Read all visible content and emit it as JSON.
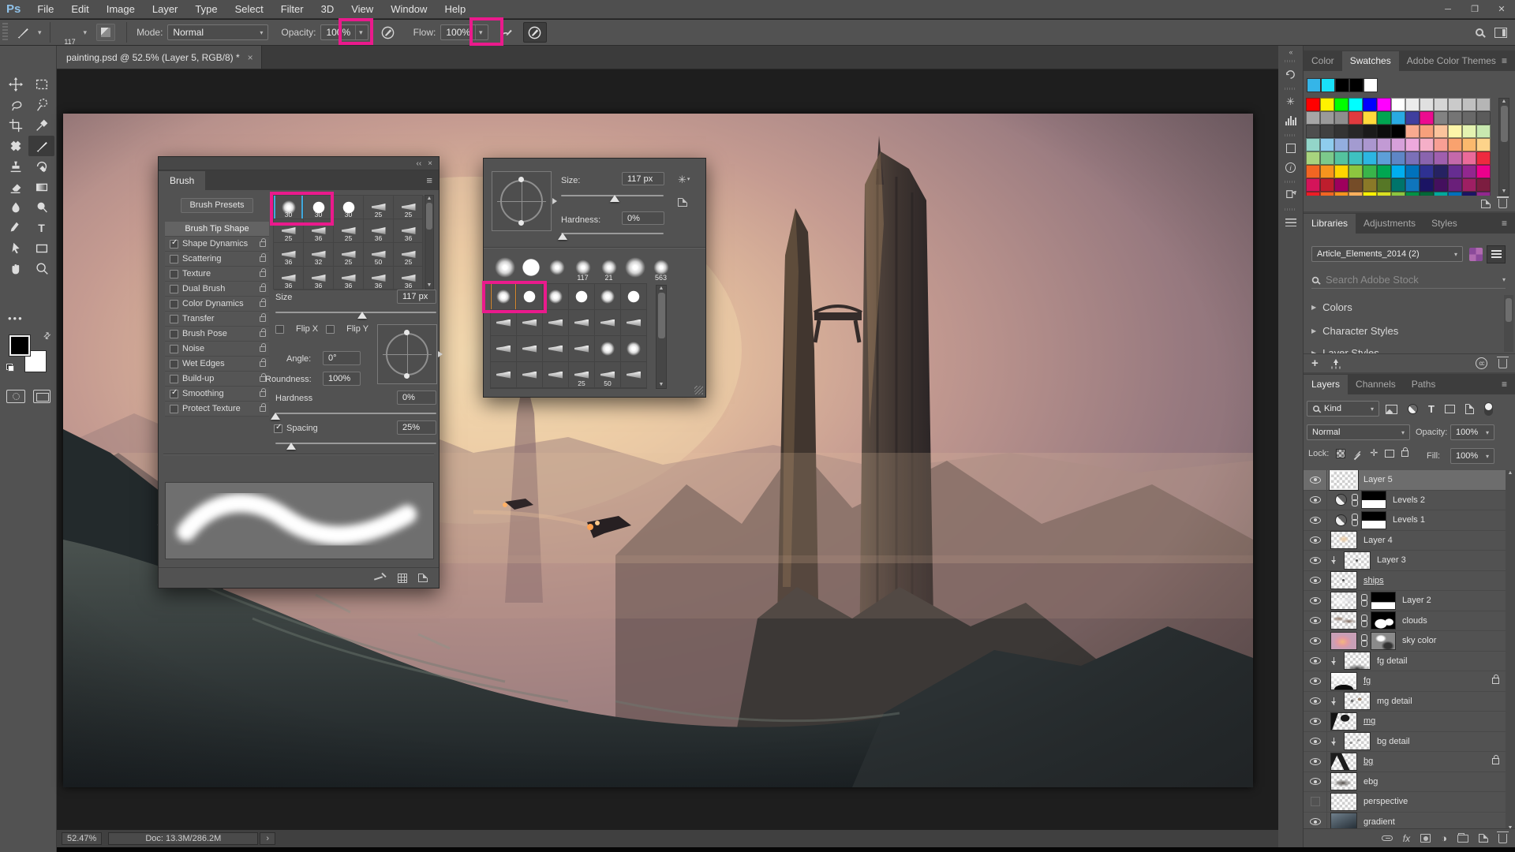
{
  "app": {
    "logo": "Ps",
    "window_controls": [
      "─",
      "❐",
      "✕"
    ]
  },
  "menu": [
    "File",
    "Edit",
    "Image",
    "Layer",
    "Type",
    "Select",
    "Filter",
    "3D",
    "View",
    "Window",
    "Help"
  ],
  "icons": {
    "chevron": "▾",
    "menu": "≡",
    "close": "×",
    "collapse": "‹‹",
    "tri": "▶",
    "up": "▲",
    "down": "▼",
    "ellipsis": "•••",
    "fx": "fx",
    "cc": "cc",
    "swap": "⇄",
    "asterisk": "✳",
    "T": "T",
    "halfcircle": "◑",
    "info": "i",
    "gt": "›"
  },
  "options_bar": {
    "brush_size": "117",
    "mode_label": "Mode:",
    "mode_value": "Normal",
    "opacity_label": "Opacity:",
    "opacity_value": "100%",
    "flow_label": "Flow:",
    "flow_value": "100%"
  },
  "document_tab": {
    "title": "painting.psd @ 52.5% (Layer 5, RGB/8) *"
  },
  "status_bar": {
    "zoom": "52.47%",
    "doc_info": "Doc: 13.3M/286.2M"
  },
  "brush_panel": {
    "title": "Brush",
    "presets_button": "Brush Presets",
    "tip_shape_label": "Brush Tip Shape",
    "settings": [
      {
        "label": "Shape Dynamics",
        "checked": true
      },
      {
        "label": "Scattering",
        "checked": false
      },
      {
        "label": "Texture",
        "checked": false
      },
      {
        "label": "Dual Brush",
        "checked": false
      },
      {
        "label": "Color Dynamics",
        "checked": false
      },
      {
        "label": "Transfer",
        "checked": false
      },
      {
        "label": "Brush Pose",
        "checked": false
      },
      {
        "label": "Noise",
        "checked": false
      },
      {
        "label": "Wet Edges",
        "checked": false
      },
      {
        "label": "Build-up",
        "checked": false
      },
      {
        "label": "Smoothing",
        "checked": true
      },
      {
        "label": "Protect Texture",
        "checked": false
      }
    ],
    "grid": [
      {
        "cells": [
          {
            "t": "soft",
            "n": "30",
            "sel": true
          },
          {
            "t": "hard",
            "n": "30"
          },
          {
            "t": "hard",
            "n": "30"
          },
          {
            "t": "tip",
            "n": "25"
          },
          {
            "t": "tip",
            "n": "25"
          }
        ]
      },
      {
        "cells": [
          {
            "t": "tip",
            "n": "25"
          },
          {
            "t": "tip",
            "n": "36"
          },
          {
            "t": "tip",
            "n": "25"
          },
          {
            "t": "tip",
            "n": "36"
          },
          {
            "t": "tip",
            "n": "36"
          }
        ]
      },
      {
        "cells": [
          {
            "t": "tip",
            "n": "36"
          },
          {
            "t": "tip",
            "n": "32"
          },
          {
            "t": "tip",
            "n": "25"
          },
          {
            "t": "tip",
            "n": "50"
          },
          {
            "t": "tip",
            "n": "25"
          }
        ]
      },
      {
        "cells": [
          {
            "t": "tip",
            "n": "36"
          },
          {
            "t": "tip",
            "n": "36"
          },
          {
            "t": "tip",
            "n": "36"
          },
          {
            "t": "tip",
            "n": "36"
          },
          {
            "t": "tip",
            "n": "36"
          }
        ]
      }
    ],
    "size_label": "Size",
    "size_value": "117 px",
    "flip_x_label": "Flip X",
    "flip_y_label": "Flip Y",
    "angle_label": "Angle:",
    "angle_value": "0°",
    "roundness_label": "Roundness:",
    "roundness_value": "100%",
    "hardness_label": "Hardness",
    "hardness_value": "0%",
    "spacing_label": "Spacing",
    "spacing_value": "25%"
  },
  "brush_popup": {
    "size_label": "Size:",
    "size_value": "117 px",
    "hardness_label": "Hardness:",
    "hardness_value": "0%",
    "recent": [
      {
        "t": "soft-lg"
      },
      {
        "t": "hard-lg"
      },
      {
        "t": "soft-md"
      },
      {
        "t": "soft-md",
        "n": "117"
      },
      {
        "t": "soft-md",
        "n": "21"
      },
      {
        "t": "soft-lg"
      },
      {
        "t": "soft-md",
        "n": "563"
      }
    ],
    "grid": [
      {
        "cells": [
          {
            "t": "soft",
            "sel": true
          },
          {
            "t": "hard"
          },
          {
            "t": "soft"
          },
          {
            "t": "hard"
          },
          {
            "t": "soft"
          },
          {
            "t": "hard"
          }
        ]
      },
      {
        "cells": [
          {
            "t": "tip"
          },
          {
            "t": "tip"
          },
          {
            "t": "tip"
          },
          {
            "t": "tip"
          },
          {
            "t": "tip"
          },
          {
            "t": "tip"
          }
        ]
      },
      {
        "cells": [
          {
            "t": "tip"
          },
          {
            "t": "tip"
          },
          {
            "t": "tip"
          },
          {
            "t": "tip"
          },
          {
            "t": "soft"
          },
          {
            "t": "soft"
          }
        ]
      },
      {
        "cells": [
          {
            "t": "tip"
          },
          {
            "t": "tip"
          },
          {
            "t": "tip"
          },
          {
            "t": "tip",
            "n": "25"
          },
          {
            "t": "tip",
            "n": "50"
          },
          {
            "t": "tip"
          }
        ]
      }
    ]
  },
  "swatches_panel": {
    "tabs": [
      {
        "label": "Color"
      },
      {
        "label": "Swatches",
        "active": true
      },
      {
        "label": "Adobe Color Themes"
      }
    ],
    "recent": [
      {
        "c": "#35b5e8"
      },
      {
        "c": "#19e0f7"
      },
      {
        "c": "#000000"
      },
      {
        "c": "#000000"
      },
      {
        "c": "#ffffff"
      }
    ],
    "grid": [
      {
        "cells": [
          {
            "c": "#ff0000"
          },
          {
            "c": "#fff200"
          },
          {
            "c": "#00ff00"
          },
          {
            "c": "#00ffff"
          },
          {
            "c": "#0000ff"
          },
          {
            "c": "#ff00ff"
          },
          {
            "c": "#ffffff"
          },
          {
            "c": "#ececec"
          },
          {
            "c": "#e0e0e0"
          },
          {
            "c": "#d5d5d5"
          },
          {
            "c": "#cacaca"
          },
          {
            "c": "#c0c0c0"
          },
          {
            "c": "#b5b5b5"
          }
        ]
      },
      {
        "cells": [
          {
            "c": "#a6a6a6"
          },
          {
            "c": "#9a9a9a"
          },
          {
            "c": "#8e8e8e"
          },
          {
            "c": "#e03a3e"
          },
          {
            "c": "#ffd93b"
          },
          {
            "c": "#00a551"
          },
          {
            "c": "#29aae2"
          },
          {
            "c": "#3f3f9e"
          },
          {
            "c": "#ec0b8f"
          },
          {
            "c": "#828282"
          },
          {
            "c": "#757575"
          },
          {
            "c": "#686868"
          },
          {
            "c": "#5b5b5b"
          }
        ]
      },
      {
        "cells": [
          {
            "c": "#4e4e4e"
          },
          {
            "c": "#414141"
          },
          {
            "c": "#343434"
          },
          {
            "c": "#272727"
          },
          {
            "c": "#1a1a1a"
          },
          {
            "c": "#0d0d0d"
          },
          {
            "c": "#000000"
          },
          {
            "c": "#f9aa8f"
          },
          {
            "c": "#f7a07c"
          },
          {
            "c": "#fbc39c"
          },
          {
            "c": "#fdf6a9"
          },
          {
            "c": "#e4f3b1"
          },
          {
            "c": "#c8e8b0"
          }
        ]
      },
      {
        "cells": [
          {
            "c": "#93d5c9"
          },
          {
            "c": "#8fcdee"
          },
          {
            "c": "#93aede"
          },
          {
            "c": "#a39bd0"
          },
          {
            "c": "#ab97cf"
          },
          {
            "c": "#c29ad4"
          },
          {
            "c": "#d7a0da"
          },
          {
            "c": "#eda9dc"
          },
          {
            "c": "#f5afc8"
          },
          {
            "c": "#f89f94"
          },
          {
            "c": "#f9a26e"
          },
          {
            "c": "#fbb96d"
          },
          {
            "c": "#fdd38a"
          }
        ]
      },
      {
        "cells": [
          {
            "c": "#a8d47e"
          },
          {
            "c": "#7cc98b"
          },
          {
            "c": "#54c29f"
          },
          {
            "c": "#3ec1c1"
          },
          {
            "c": "#2cb6e2"
          },
          {
            "c": "#5d9fd8"
          },
          {
            "c": "#5e86c6"
          },
          {
            "c": "#7b70b8"
          },
          {
            "c": "#8a64ae"
          },
          {
            "c": "#a05fae"
          },
          {
            "c": "#c469aa"
          },
          {
            "c": "#ea6a9a"
          },
          {
            "c": "#ee2a3f"
          }
        ]
      },
      {
        "cells": [
          {
            "c": "#f26522"
          },
          {
            "c": "#f7941e"
          },
          {
            "c": "#ffd400"
          },
          {
            "c": "#8dc63f"
          },
          {
            "c": "#39b54a"
          },
          {
            "c": "#00a651"
          },
          {
            "c": "#00aeef"
          },
          {
            "c": "#0072bc"
          },
          {
            "c": "#2e3192"
          },
          {
            "c": "#262262"
          },
          {
            "c": "#662d91"
          },
          {
            "c": "#92278f"
          },
          {
            "c": "#ec008c"
          }
        ]
      },
      {
        "cells": [
          {
            "c": "#d4145a"
          },
          {
            "c": "#be1e2d"
          },
          {
            "c": "#9e005d"
          },
          {
            "c": "#754c28"
          },
          {
            "c": "#8a7928"
          },
          {
            "c": "#567726"
          },
          {
            "c": "#00746b"
          },
          {
            "c": "#0f75bc"
          },
          {
            "c": "#1b1464"
          },
          {
            "c": "#44105e"
          },
          {
            "c": "#6a1f7a"
          },
          {
            "c": "#9e1f63"
          },
          {
            "c": "#7c1d40"
          }
        ]
      },
      {
        "cells": [
          {
            "c": "#ed1c24"
          },
          {
            "c": "#f26522"
          },
          {
            "c": "#f7941e"
          },
          {
            "c": "#fbaf5c"
          },
          {
            "c": "#fff200"
          },
          {
            "c": "#d9e021"
          },
          {
            "c": "#8dc63f"
          },
          {
            "c": "#009245"
          },
          {
            "c": "#006837"
          },
          {
            "c": "#00a99d"
          },
          {
            "c": "#0071bc"
          },
          {
            "c": "#1b1464"
          },
          {
            "c": "#93278f"
          }
        ]
      }
    ]
  },
  "libraries_panel": {
    "tabs": [
      {
        "label": "Libraries",
        "active": true
      },
      {
        "label": "Adjustments"
      },
      {
        "label": "Styles"
      }
    ],
    "library_value": "Article_Elements_2014 (2)",
    "search_placeholder": "Search Adobe Stock",
    "sections": [
      "Colors",
      "Character Styles",
      "Layer Styles"
    ]
  },
  "layers_panel": {
    "tabs": [
      {
        "label": "Layers",
        "active": true
      },
      {
        "label": "Channels"
      },
      {
        "label": "Paths"
      }
    ],
    "kind_value": "Kind",
    "blend_value": "Normal",
    "opacity_label": "Opacity:",
    "opacity_value": "100%",
    "lock_label": "Lock:",
    "fill_label": "Fill:",
    "fill_value": "100%",
    "layers": [
      {
        "name": "Layer 5",
        "thumb": "t-checker",
        "selected": true
      },
      {
        "name": "Levels 2",
        "adjustment": true,
        "linked": true,
        "mask": "m-ridge"
      },
      {
        "name": "Levels 1",
        "adjustment": true,
        "linked": true,
        "mask": "m-ridge"
      },
      {
        "name": "Layer 4",
        "thumb": "t-faint"
      },
      {
        "name": "Layer 3",
        "clipped": true,
        "thumb": "t-dot"
      },
      {
        "name": "ships",
        "underline": true,
        "thumb": "t-dot"
      },
      {
        "name": "Layer 2",
        "linked": true,
        "thumb": "t-cloudy",
        "mask": "m-ridge2"
      },
      {
        "name": "clouds",
        "linked": true,
        "thumb": "t-clouds",
        "mask": "m-blob"
      },
      {
        "name": "sky color",
        "linked": true,
        "thumb": "t-sky",
        "mask": "m-grey"
      },
      {
        "name": "fg detail",
        "clipped": true,
        "thumb": "t-fgd"
      },
      {
        "name": "fg",
        "underline": true,
        "locked": true,
        "thumb": "t-fg"
      },
      {
        "name": "mg detail",
        "clipped": true,
        "thumb": "t-mgd"
      },
      {
        "name": "mg",
        "underline": true,
        "thumb": "t-mg"
      },
      {
        "name": "bg detail",
        "clipped": true,
        "thumb": "t-bgd"
      },
      {
        "name": "bg",
        "underline": true,
        "locked": true,
        "thumb": "t-bg"
      },
      {
        "name": "ebg",
        "thumb": "t-ebg"
      },
      {
        "name": "perspective",
        "hidden": true,
        "thumb": "t-checker"
      },
      {
        "name": "gradient",
        "thumb": "t-grad"
      }
    ]
  },
  "annotation_color": "#ea1a8c"
}
